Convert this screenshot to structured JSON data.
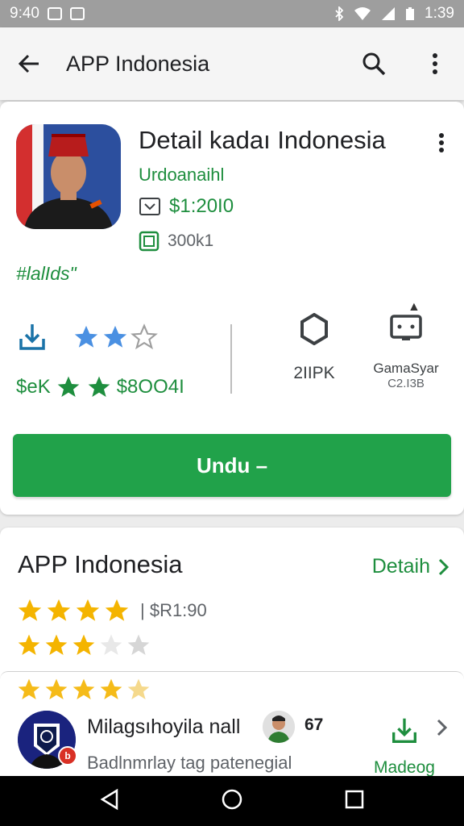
{
  "status_bar": {
    "time_left": "9:40",
    "time_right": "1:39"
  },
  "app_bar": {
    "title": "APP Indonesia",
    "back_icon": "arrow-back-icon",
    "search_icon": "search-icon",
    "menu_icon": "more-vert-icon"
  },
  "app": {
    "title": "Detail kadaı Indonesia",
    "developer": "Urdoanaihl",
    "price": "$1:20I0",
    "size": "300k1",
    "tagline": "#lalIds\"",
    "stat_downloads": "$eK",
    "stat_rating_value": "$8OO4I",
    "rating_stars_top": 2.5,
    "center_label": "2IIPK",
    "right_label": "GamaSyar",
    "right_sub": "C2.I3B",
    "install_label": "Undu –"
  },
  "about": {
    "title": "APP Indonesia",
    "detail_label": "Detaih",
    "rating_text": "| $R1:90",
    "stars_row_1": 5,
    "stars_row_2": 3
  },
  "review": {
    "name": "Milagsıhoyila nall",
    "count": "67",
    "text": "Badlnmrlay tag patenegial",
    "action_label": "Madeog",
    "badge": "b"
  },
  "colors": {
    "accent_green": "#21a24a",
    "link_green": "#1e8e3e",
    "star_yellow": "#f4b400",
    "star_blue": "#4a90e2"
  }
}
